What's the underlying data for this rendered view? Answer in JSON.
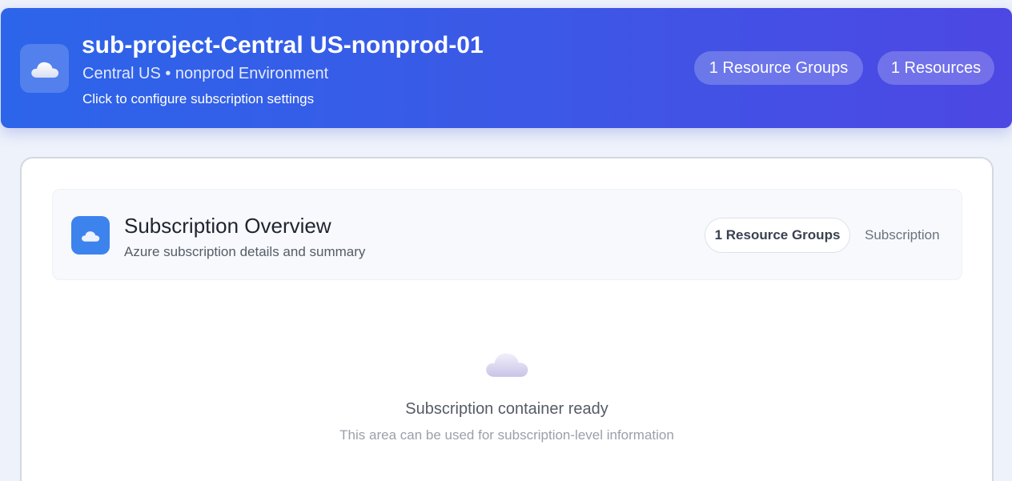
{
  "header": {
    "title": "sub-project-Central US-nonprod-01",
    "subtitle": "Central US • nonprod Environment",
    "hint": "Click to configure subscription settings",
    "icon": "cloud-icon",
    "badges": {
      "resource_groups": "1 Resource Groups",
      "resources": "1 Resources"
    },
    "colors": {
      "gradient_start": "#2c65ea",
      "gradient_end": "#4d47e4"
    }
  },
  "overview": {
    "icon": "cloud-icon",
    "title": "Subscription Overview",
    "subtitle": "Azure subscription details and summary",
    "badge": "1 Resource Groups",
    "type_label": "Subscription",
    "accent": "#3d83ee"
  },
  "empty_state": {
    "icon": "cloud-icon",
    "title": "Subscription container ready",
    "message": "This area can be used for subscription-level information"
  }
}
